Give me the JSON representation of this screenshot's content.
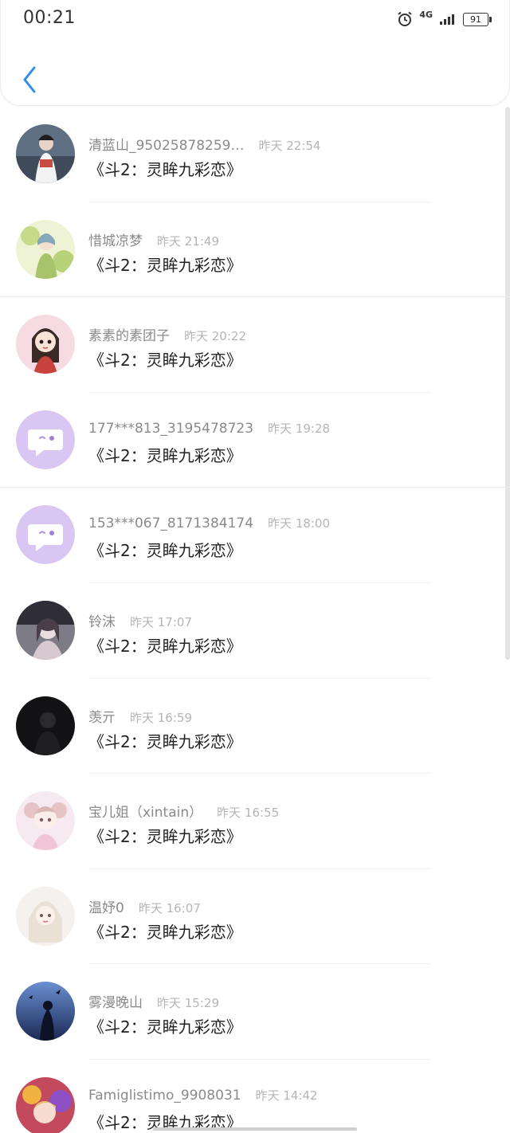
{
  "status_bar": {
    "time": "00:21",
    "network": "4G",
    "battery": "91",
    "icons": [
      "alarm-icon",
      "signal-icon",
      "battery-icon"
    ]
  },
  "header": {
    "back_icon": "chevron-left-icon",
    "accent_color": "#2f8fe6"
  },
  "list": [
    {
      "name": "清蓝山_95025878259…",
      "time": "昨天 22:54",
      "title": "《斗2：灵眸九彩恋》",
      "avatar": "avatar-photo"
    },
    {
      "name": "惜城凉梦",
      "time": "昨天 21:49",
      "title": "《斗2：灵眸九彩恋》",
      "avatar": "avatar-illustration-green"
    },
    {
      "name": "素素的素团子",
      "time": "昨天 20:22",
      "title": "《斗2：灵眸九彩恋》",
      "avatar": "avatar-illustration-girl"
    },
    {
      "name": "177***813_3195478723",
      "time": "昨天 19:28",
      "title": "《斗2：灵眸九彩恋》",
      "avatar": "default-chat-avatar"
    },
    {
      "name": "153***067_8171384174",
      "time": "昨天 18:00",
      "title": "《斗2：灵眸九彩恋》",
      "avatar": "default-chat-avatar"
    },
    {
      "name": "铃沫",
      "time": "昨天 17:07",
      "title": "《斗2：灵眸九彩恋》",
      "avatar": "avatar-illustration-dark"
    },
    {
      "name": "羡亓",
      "time": "昨天 16:59",
      "title": "《斗2：灵眸九彩恋》",
      "avatar": "avatar-photo-dark"
    },
    {
      "name": "宝儿姐（xintain）",
      "time": "昨天 16:55",
      "title": "《斗2：灵眸九彩恋》",
      "avatar": "avatar-illustration-pink"
    },
    {
      "name": "温妤0",
      "time": "昨天 16:07",
      "title": "《斗2：灵眸九彩恋》",
      "avatar": "avatar-illustration-white"
    },
    {
      "name": "雾漫晚山",
      "time": "昨天 15:29",
      "title": "《斗2：灵眸九彩恋》",
      "avatar": "avatar-illustration-night"
    },
    {
      "name": "Famiglistimo_9908031",
      "time": "昨天 14:42",
      "title": "《斗2：灵眸九彩恋》",
      "avatar": "avatar-illustration-colorful"
    }
  ]
}
